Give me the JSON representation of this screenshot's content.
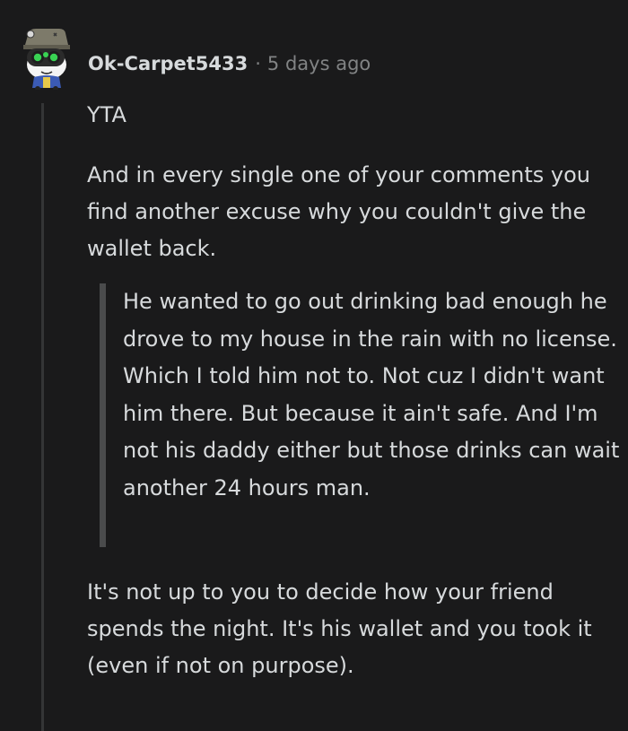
{
  "comment": {
    "username": "Ok-Carpet5433",
    "separator": "·",
    "timestamp": "5 days ago",
    "paragraphs": [
      "YTA",
      "And in every single one of your comments you find another excuse why you couldn't give the wallet back.",
      "It's not up to you to decide how your friend spends the night. It's his wallet and you took it (even if not on purpose)."
    ],
    "blockquote": "He wanted to go out drinking bad enough he drove to my house in the rain with no license. Which I told him not to. Not cuz I didn't want him there. But because it ain't safe. And I'm not his daddy either but those drinks can wait another 24 hours man.",
    "avatar_icon": "snoo-avatar-icon"
  },
  "colors": {
    "background": "#1a1a1b",
    "text": "#d7dadc",
    "meta": "#818384",
    "thread_line": "#343536",
    "quote_bar": "#4a4b4c",
    "avatar_goggles": "#39d353"
  }
}
